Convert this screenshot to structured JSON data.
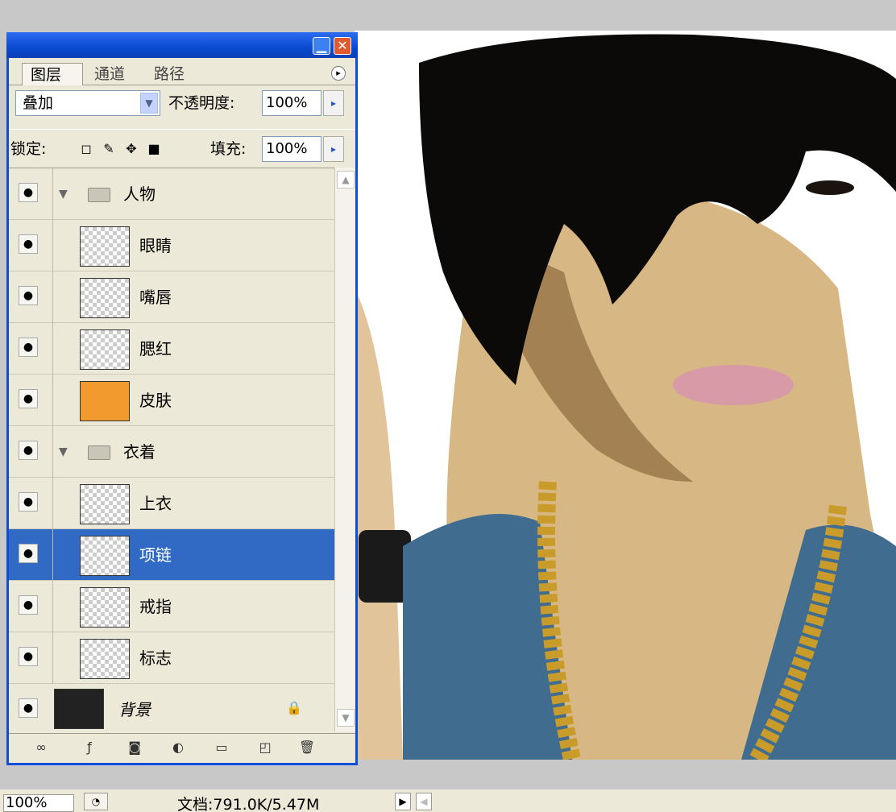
{
  "panel": {
    "tabs": {
      "layers": "图层",
      "channels": "通道",
      "paths": "路径"
    },
    "blend_mode": "叠加",
    "opacity_label": "不透明度:",
    "opacity_value": "100%",
    "lock_label": "锁定:",
    "fill_label": "填充:",
    "fill_value": "100%",
    "layers": [
      {
        "type": "group",
        "name": "人物"
      },
      {
        "type": "layer",
        "name": "眼睛"
      },
      {
        "type": "layer",
        "name": "嘴唇"
      },
      {
        "type": "layer",
        "name": "腮红"
      },
      {
        "type": "layer",
        "name": "皮肤"
      },
      {
        "type": "group",
        "name": "衣着"
      },
      {
        "type": "layer",
        "name": "上衣"
      },
      {
        "type": "layer",
        "name": "项链",
        "selected": true
      },
      {
        "type": "layer",
        "name": "戒指"
      },
      {
        "type": "layer",
        "name": "标志"
      },
      {
        "type": "background",
        "name": "背景",
        "locked": true
      }
    ]
  },
  "status": {
    "zoom": "100%",
    "doc_info": "文档:791.0K/5.47M"
  },
  "colors": {
    "titlebar": "#0a4fd6",
    "selection": "#316ac5",
    "panel_bg": "#ece9d8"
  },
  "icons": [
    "minimize-icon",
    "close-icon",
    "panel-menu-icon",
    "dropdown-arrow-icon",
    "eye-icon",
    "folder-icon",
    "lock-icon",
    "link-icon",
    "fx-icon",
    "mask-icon",
    "adjustment-icon",
    "new-group-icon",
    "new-layer-icon",
    "trash-icon"
  ]
}
